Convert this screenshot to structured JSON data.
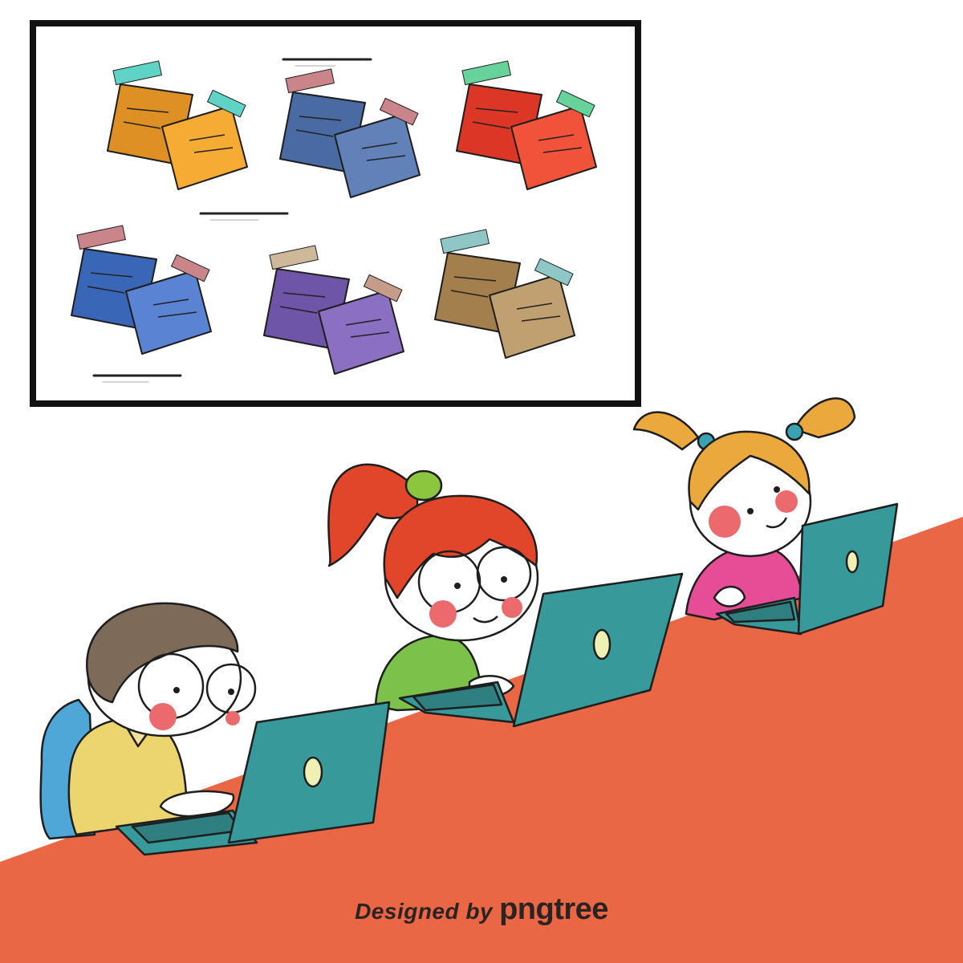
{
  "palette": {
    "background": "#ffffff",
    "desk": "#e96744",
    "board_frame": "#111111",
    "laptop": "#37999a",
    "outline": "#1e1e1e",
    "skin": "#ffffff",
    "blush": "#ea6a6e"
  },
  "board": {
    "note_groups": [
      {
        "name": "orange",
        "back": "#de9024",
        "front": "#f5ab34",
        "tape_back": "#5ed3c6",
        "tape_front": "#5ed3c6"
      },
      {
        "name": "blue",
        "back": "#4a6aa4",
        "front": "#6181b8",
        "tape_back": "#c9858a",
        "tape_front": "#c9858a"
      },
      {
        "name": "red",
        "back": "#db3626",
        "front": "#f0533a",
        "tape_back": "#67d39b",
        "tape_front": "#67d39b"
      },
      {
        "name": "royal-blue",
        "back": "#3a66b8",
        "front": "#5a83d3",
        "tape_back": "#c9858a",
        "tape_front": "#c9858a"
      },
      {
        "name": "purple",
        "back": "#6e55a8",
        "front": "#8b6fc3",
        "tape_back": "#cdb89a",
        "tape_front": "#c79b8a"
      },
      {
        "name": "brown",
        "back": "#a27f4c",
        "front": "#c0a070",
        "tape_back": "#8ec7c6",
        "tape_front": "#8ec7c6"
      }
    ]
  },
  "children": [
    {
      "name": "boy",
      "hair": "#7d6a58",
      "shirt": "#ecd56f",
      "backpack": "#4ea7d6"
    },
    {
      "name": "red-haired-girl",
      "hair": "#e2462a",
      "hair_tie": "#8cc63f",
      "shirt": "#7cc14a"
    },
    {
      "name": "pigtail-girl",
      "hair": "#eba93d",
      "hair_tie": "#3aa3b3",
      "shirt": "#e64d96"
    }
  ],
  "credit": {
    "prefix": "Designed by",
    "brand": "pngtree"
  }
}
